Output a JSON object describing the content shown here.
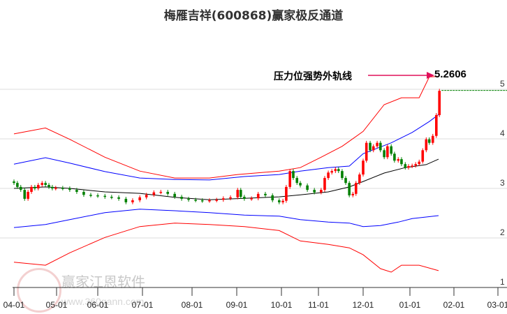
{
  "title": "梅雁吉祥(600868)赢家极反通道",
  "annotation": {
    "label": "压力位强势外轨线",
    "value": "5.2606"
  },
  "watermark": {
    "brand": "赢家江恩软件",
    "url": "www.360gann.com",
    "seal": "江赢恩家"
  },
  "colors": {
    "up": "#ff0000",
    "down": "#008000",
    "outer": "#ff0000",
    "inner": "#0000ff",
    "mid": "#000000",
    "arrow": "#e0105a"
  },
  "chart_data": {
    "type": "candlestick-channel",
    "title": "梅雁吉祥(600868)赢家极反通道",
    "x_unit": "month index from 04-01",
    "xticks": [
      "04-01",
      "05-01",
      "06-01",
      "07-01",
      "08-01",
      "09-01",
      "10-01",
      "11-01",
      "12-01",
      "01-01",
      "02-01",
      "03-01"
    ],
    "yticks": [
      "1",
      "2",
      "3",
      "4",
      "5"
    ],
    "ylim": [
      1,
      5.4
    ],
    "series": [
      {
        "name": "outer-upper",
        "points": [
          [
            0,
            4.1
          ],
          [
            0.74,
            4.22
          ],
          [
            1.32,
            3.99
          ],
          [
            2.16,
            3.63
          ],
          [
            2.94,
            3.35
          ],
          [
            3.65,
            3.21
          ],
          [
            4.39,
            3.21
          ],
          [
            5.02,
            3.28
          ],
          [
            5.95,
            3.35
          ],
          [
            6.51,
            3.42
          ],
          [
            7.06,
            3.63
          ],
          [
            7.53,
            3.85
          ],
          [
            8.0,
            4.15
          ],
          [
            8.45,
            4.69
          ],
          [
            8.82,
            4.83
          ],
          [
            9.21,
            4.83
          ],
          [
            9.44,
            5.25
          ],
          [
            9.65,
            5.26
          ]
        ]
      },
      {
        "name": "inner-upper",
        "points": [
          [
            0,
            3.49
          ],
          [
            0.74,
            3.62
          ],
          [
            1.32,
            3.51
          ],
          [
            2.16,
            3.34
          ],
          [
            2.94,
            3.21
          ],
          [
            3.65,
            3.18
          ],
          [
            4.39,
            3.17
          ],
          [
            5.17,
            3.24
          ],
          [
            5.95,
            3.28
          ],
          [
            6.51,
            3.35
          ],
          [
            7.22,
            3.42
          ],
          [
            7.69,
            3.45
          ],
          [
            8.0,
            3.7
          ],
          [
            8.6,
            3.92
          ],
          [
            9.05,
            4.13
          ],
          [
            9.44,
            4.35
          ],
          [
            9.65,
            4.49
          ]
        ]
      },
      {
        "name": "middle",
        "points": [
          [
            0,
            3.0
          ],
          [
            0.74,
            3.03
          ],
          [
            1.32,
            3.0
          ],
          [
            2.16,
            2.93
          ],
          [
            2.94,
            2.9
          ],
          [
            3.65,
            2.82
          ],
          [
            4.39,
            2.77
          ],
          [
            5.17,
            2.8
          ],
          [
            5.95,
            2.83
          ],
          [
            6.51,
            2.87
          ],
          [
            7.22,
            2.93
          ],
          [
            7.69,
            3.03
          ],
          [
            8.0,
            3.14
          ],
          [
            8.45,
            3.31
          ],
          [
            8.9,
            3.42
          ],
          [
            9.37,
            3.48
          ],
          [
            9.65,
            3.59
          ]
        ]
      },
      {
        "name": "inner-lower",
        "points": [
          [
            0,
            2.21
          ],
          [
            0.74,
            2.27
          ],
          [
            1.32,
            2.37
          ],
          [
            2.16,
            2.51
          ],
          [
            2.94,
            2.58
          ],
          [
            3.65,
            2.55
          ],
          [
            4.39,
            2.51
          ],
          [
            5.17,
            2.46
          ],
          [
            5.95,
            2.44
          ],
          [
            6.51,
            2.37
          ],
          [
            7.22,
            2.32
          ],
          [
            7.69,
            2.3
          ],
          [
            8.0,
            2.23
          ],
          [
            8.37,
            2.25
          ],
          [
            8.75,
            2.32
          ],
          [
            9.05,
            2.39
          ],
          [
            9.65,
            2.45
          ]
        ]
      },
      {
        "name": "outer-lower",
        "points": [
          [
            0,
            1.51
          ],
          [
            0.74,
            1.45
          ],
          [
            1.32,
            1.7
          ],
          [
            2.16,
            2.01
          ],
          [
            2.94,
            2.23
          ],
          [
            3.65,
            2.3
          ],
          [
            4.39,
            2.27
          ],
          [
            5.17,
            2.23
          ],
          [
            5.95,
            2.15
          ],
          [
            6.51,
            1.94
          ],
          [
            7.22,
            1.87
          ],
          [
            7.69,
            1.8
          ],
          [
            8.0,
            1.66
          ],
          [
            8.37,
            1.38
          ],
          [
            8.6,
            1.31
          ],
          [
            8.82,
            1.45
          ],
          [
            9.21,
            1.45
          ],
          [
            9.65,
            1.34
          ]
        ]
      }
    ],
    "closes": [
      [
        0,
        3.11
      ],
      [
        0.08,
        3.03
      ],
      [
        0.16,
        2.97
      ],
      [
        0.25,
        2.79
      ],
      [
        0.33,
        2.93
      ],
      [
        0.41,
        3.03
      ],
      [
        0.49,
        3.0
      ],
      [
        0.57,
        3.07
      ],
      [
        0.66,
        3.11
      ],
      [
        0.74,
        3.07
      ],
      [
        0.82,
        3.03
      ],
      [
        0.9,
        3.0
      ],
      [
        0.98,
        3.01
      ],
      [
        1.15,
        3.0
      ],
      [
        1.32,
        2.97
      ],
      [
        1.49,
        2.93
      ],
      [
        1.66,
        2.87
      ],
      [
        1.83,
        2.86
      ],
      [
        2.0,
        2.85
      ],
      [
        2.16,
        2.83
      ],
      [
        2.31,
        2.82
      ],
      [
        2.47,
        2.79
      ],
      [
        2.63,
        2.72
      ],
      [
        2.78,
        2.76
      ],
      [
        2.94,
        2.82
      ],
      [
        3.08,
        2.87
      ],
      [
        3.23,
        2.92
      ],
      [
        3.37,
        2.93
      ],
      [
        3.51,
        2.89
      ],
      [
        3.65,
        2.83
      ],
      [
        3.79,
        2.79
      ],
      [
        3.93,
        2.77
      ],
      [
        4.08,
        2.76
      ],
      [
        4.23,
        2.75
      ],
      [
        4.39,
        2.76
      ],
      [
        4.55,
        2.77
      ],
      [
        4.7,
        2.8
      ],
      [
        4.86,
        2.82
      ],
      [
        5.02,
        2.97
      ],
      [
        5.09,
        2.83
      ],
      [
        5.17,
        2.79
      ],
      [
        5.33,
        2.8
      ],
      [
        5.48,
        2.89
      ],
      [
        5.64,
        2.86
      ],
      [
        5.8,
        2.76
      ],
      [
        5.95,
        2.72
      ],
      [
        6.04,
        2.75
      ],
      [
        6.13,
        3.03
      ],
      [
        6.23,
        3.35
      ],
      [
        6.32,
        3.21
      ],
      [
        6.42,
        3.11
      ],
      [
        6.51,
        3.06
      ],
      [
        6.7,
        2.97
      ],
      [
        6.89,
        2.92
      ],
      [
        7.06,
        2.97
      ],
      [
        7.14,
        3.21
      ],
      [
        7.22,
        3.32
      ],
      [
        7.3,
        3.35
      ],
      [
        7.38,
        3.39
      ],
      [
        7.45,
        3.35
      ],
      [
        7.53,
        3.21
      ],
      [
        7.61,
        3.11
      ],
      [
        7.69,
        2.86
      ],
      [
        7.77,
        2.89
      ],
      [
        7.84,
        3.11
      ],
      [
        7.92,
        3.28
      ],
      [
        8.0,
        3.56
      ],
      [
        8.07,
        3.92
      ],
      [
        8.15,
        3.77
      ],
      [
        8.22,
        3.85
      ],
      [
        8.3,
        3.92
      ],
      [
        8.37,
        3.77
      ],
      [
        8.45,
        3.63
      ],
      [
        8.52,
        3.85
      ],
      [
        8.6,
        3.7
      ],
      [
        8.67,
        3.56
      ],
      [
        8.75,
        3.59
      ],
      [
        8.82,
        3.49
      ],
      [
        8.9,
        3.42
      ],
      [
        8.97,
        3.45
      ],
      [
        9.05,
        3.46
      ],
      [
        9.13,
        3.49
      ],
      [
        9.21,
        3.54
      ],
      [
        9.29,
        3.77
      ],
      [
        9.37,
        3.99
      ],
      [
        9.44,
        3.92
      ],
      [
        9.52,
        4.06
      ],
      [
        9.6,
        4.48
      ],
      [
        9.67,
        4.97
      ]
    ]
  }
}
